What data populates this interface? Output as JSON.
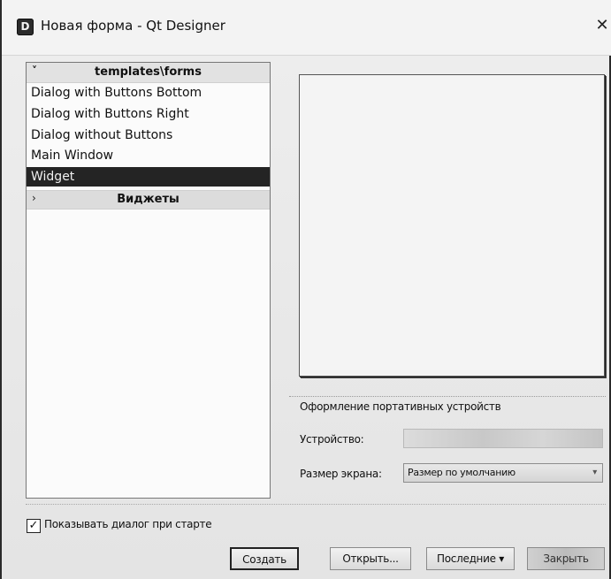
{
  "window": {
    "app_icon": "D",
    "title": "Новая форма - Qt Designer",
    "close_glyph": "✕"
  },
  "tree": {
    "expand_glyph": "˅",
    "header_label": "templates\\forms",
    "items": [
      {
        "label": "Dialog with Buttons Bottom",
        "selected": false
      },
      {
        "label": "Dialog with Buttons Right",
        "selected": false
      },
      {
        "label": "Dialog without Buttons",
        "selected": false
      },
      {
        "label": "Main Window",
        "selected": false
      },
      {
        "label": "Widget",
        "selected": true
      }
    ],
    "group_glyph": "›",
    "group_label": "Виджеты"
  },
  "device": {
    "section_title": "Оформление портативных устройств",
    "device_label": "Устройство:",
    "device_value": "",
    "screen_size_label": "Размер экрана:",
    "screen_size_value": "Размер по умолчанию",
    "dropdown_glyph": "▾"
  },
  "footer": {
    "show_on_start_label": "Показывать диалог при старте",
    "show_on_start_checked": true,
    "check_glyph": "✓",
    "create_label": "Создать",
    "open_label": "Открыть...",
    "recent_label": "Последние ▾",
    "close_label": "Закрыть"
  }
}
